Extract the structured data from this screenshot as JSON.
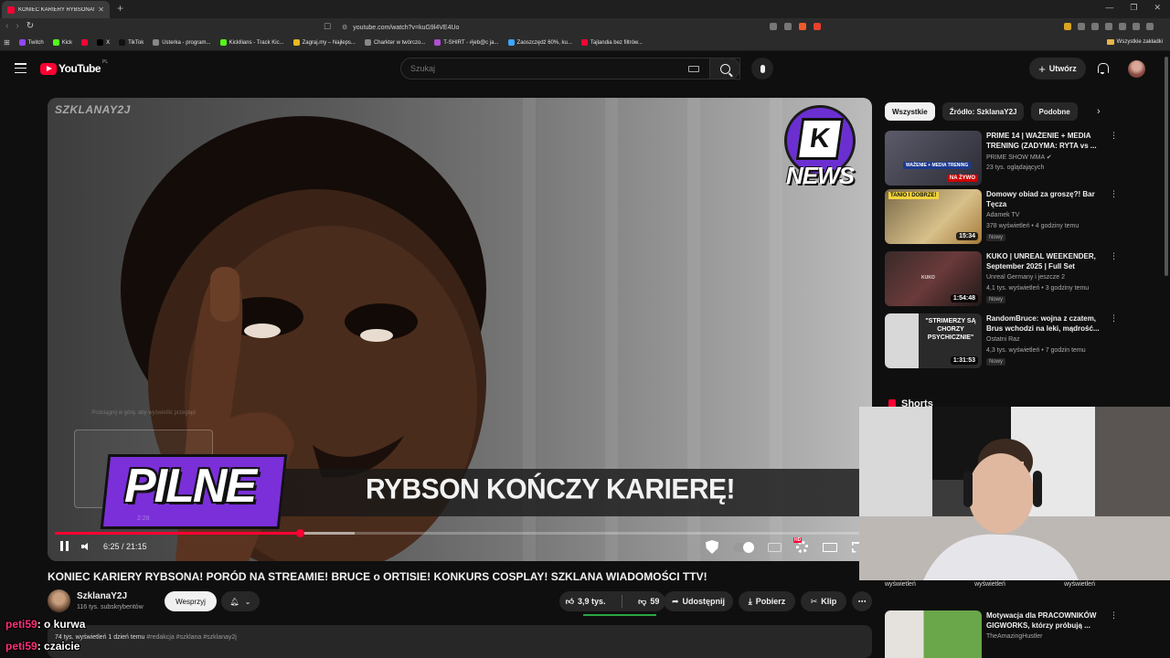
{
  "browser": {
    "tab_title": "KONIEC KARIERY RYBSONA! I",
    "url": "youtube.com/watch?v=kuG9l4VE4Uo",
    "bookmarks": [
      "Twitch",
      "Kick",
      "X",
      "TikTok",
      "Usterka - program...",
      "Kickllians - Track Kic...",
      "Zagraj.my – Najleps...",
      "Charkter w twórczo...",
      "T-SHIRT - #jeb@c ja...",
      "Zaoszczędź 60%, ku...",
      "Tajlandia bez filtrów..."
    ],
    "bookmarks_right": "Wszystkie zakładki"
  },
  "youtube": {
    "logo_text": "YouTube",
    "country_code": "PL",
    "search_placeholder": "Szukaj",
    "create_label": "Utwórz"
  },
  "video": {
    "watermark": "SZKLANAY2J",
    "lower_third": "RYBSON KOŃCZY KARIERĘ!",
    "badge": "PILNE",
    "logo_word": "NEWS",
    "hover_preview_text": "Podciągnij w górę, aby wyświetlić przegląd",
    "hover_preview_time": "2:28",
    "time_display": "6:25 / 21:15",
    "progress_fraction": 0.302,
    "buffered_fraction": 0.37,
    "title": "KONIEC KARIERY RYBSONA! PORÓD NA STREAMIE! BRUCE o ORTISIE! KONKURS COSPLAY! SZKLANA WIADOMOŚCI TTV!",
    "channel_name": "SzklanaY2J",
    "subscribers": "116 tys. subskrybentów",
    "support_label": "Wesprzyj",
    "likes": "3,9 tys.",
    "dislikes": "59",
    "share_label": "Udostępnij",
    "download_label": "Pobierz",
    "clip_label": "Klip",
    "desc_meta": "74 tys. wyświetleń  1 dzień temu",
    "desc_tags": "#redakcja #szklana #szklanay2j"
  },
  "sidebar": {
    "chips": [
      "Wszystkie",
      "Źródło: SzklanaY2J",
      "Podobne"
    ],
    "recommendations": [
      {
        "title": "PRIME 14 | WAŻENIE + MEDIA TRENING (ZADYMA: RYTA vs ...",
        "channel": "PRIME SHOW MMA ✔",
        "meta": "23 tys. oglądających",
        "badge": "NA ŻYWO",
        "new": ""
      },
      {
        "title": "Domowy obiad za groszę?! Bar Tęcza",
        "channel": "Adamek TV",
        "meta": "378 wyświetleń • 4 godziny temu",
        "duration": "15:34",
        "new": "Nowy"
      },
      {
        "title": "KUKO | UNREAL WEEKENDER, September 2025 | Full Set",
        "channel": "Unreal Germany i jeszcze 2",
        "meta": "4,1 tys. wyświetleń • 3 godziny temu",
        "duration": "1:54:48",
        "new": "Nowy"
      },
      {
        "title": "RandomBruce: wojna z czatem, Brus wchodzi na leki, mądrość...",
        "channel": "Ostatni Raz",
        "meta": "4,3 tys. wyświetleń • 7 godzin temu",
        "duration": "1:31:53",
        "new": "Nowy"
      },
      {
        "title": "Motywacja dla PRACOWNIKÓW GIGWORKS, którzy próbują ...",
        "channel": "TheAmazingHustler",
        "meta": "",
        "new": ""
      }
    ],
    "thumb_texts": [
      "WAŻENIE + MEDIA TRENING",
      "TANIO I DOBRZE!",
      "KUKO",
      "\"STRIMERZY SĄ CHORZY PSYCHICZNIE\""
    ],
    "shorts_heading": "Shorts",
    "shorts_views": [
      "wyświetleń",
      "wyświetleń",
      "wyświetleń"
    ]
  },
  "chat": [
    {
      "user": "peti59",
      "text": ": o kurwa"
    },
    {
      "user": "peti59",
      "text": ": czaicie"
    }
  ]
}
